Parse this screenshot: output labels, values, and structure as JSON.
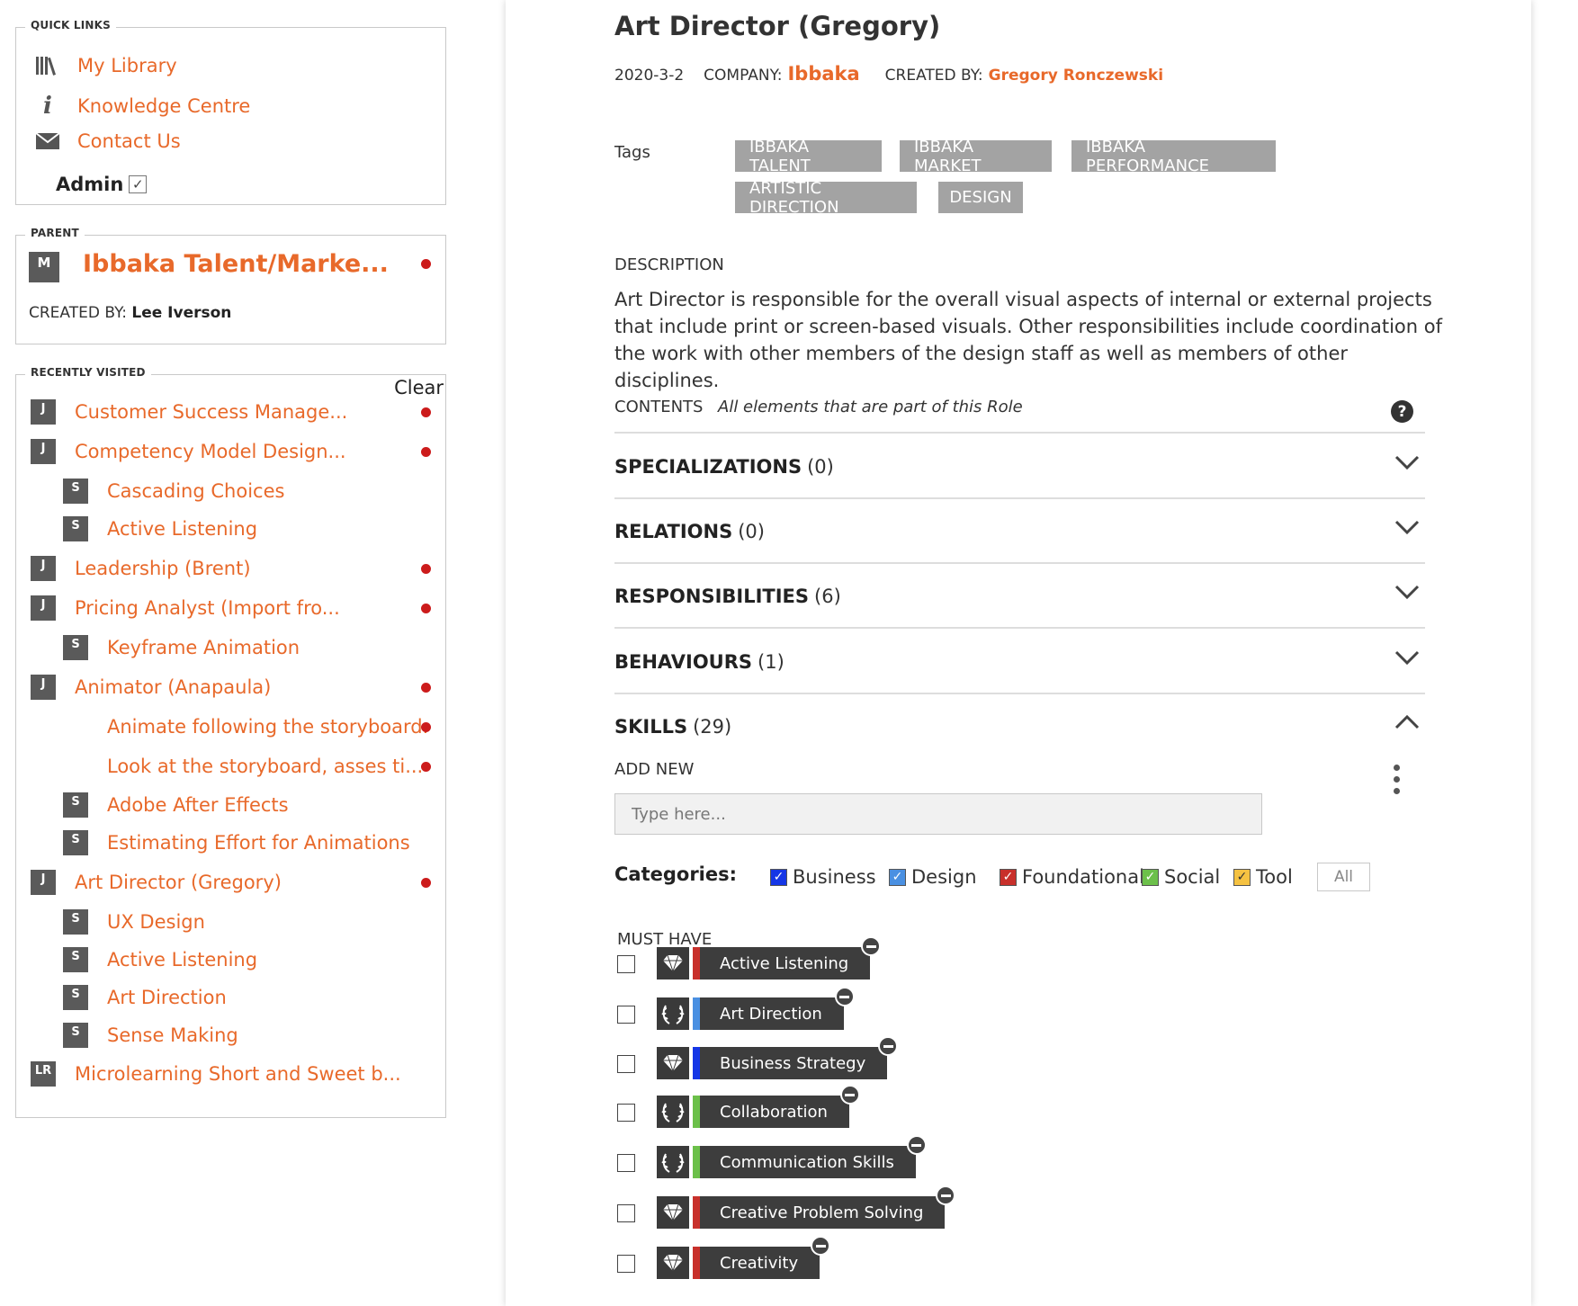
{
  "sidebar": {
    "quick_links": {
      "legend": "QUICK LINKS",
      "items": [
        {
          "label": "My Library",
          "icon": "library-icon"
        },
        {
          "label": "Knowledge Centre",
          "icon": "info-icon"
        },
        {
          "label": "Contact Us",
          "icon": "envelope-icon"
        }
      ],
      "admin_label": "Admin",
      "admin_checked": true
    },
    "parent": {
      "legend": "PARENT",
      "badge": "M",
      "title": "Ibbaka Talent/Marke...",
      "created_by_label": "CREATED BY:",
      "created_by": "Lee Iverson"
    },
    "recently_visited": {
      "legend": "RECENTLY VISITED",
      "clear_label": "Clear",
      "items": [
        {
          "badge": "J",
          "label": "Customer Success Manage...",
          "dot": true
        },
        {
          "badge": "J",
          "label": "Competency Model Design...",
          "dot": true
        },
        {
          "badge": "S",
          "label": "Cascading Choices",
          "dot": false
        },
        {
          "badge": "S",
          "label": "Active Listening",
          "dot": false
        },
        {
          "badge": "J",
          "label": "Leadership (Brent)",
          "dot": true
        },
        {
          "badge": "J",
          "label": "Pricing Analyst (Import fro...",
          "dot": true
        },
        {
          "badge": "S",
          "label": "Keyframe Animation",
          "dot": false
        },
        {
          "badge": "J",
          "label": "Animator (Anapaula)",
          "dot": true
        },
        {
          "badge": "",
          "label": "Animate following the storyboard.",
          "dot": true
        },
        {
          "badge": "",
          "label": "Look at the storyboard, asses ti...",
          "dot": true
        },
        {
          "badge": "S",
          "label": "Adobe After Effects",
          "dot": false
        },
        {
          "badge": "S",
          "label": "Estimating Effort for Animations",
          "dot": false
        },
        {
          "badge": "J",
          "label": "Art Director (Gregory)",
          "dot": true
        },
        {
          "badge": "S",
          "label": "UX Design",
          "dot": false
        },
        {
          "badge": "S",
          "label": "Active Listening",
          "dot": false
        },
        {
          "badge": "S",
          "label": "Art Direction",
          "dot": false
        },
        {
          "badge": "S",
          "label": "Sense Making",
          "dot": false
        },
        {
          "badge": "LR",
          "label": "Microlearning Short and Sweet b...",
          "dot": false
        }
      ]
    }
  },
  "main": {
    "title": "Art Director (Gregory)",
    "date": "2020-3-2",
    "company_label": "COMPANY:",
    "company": "Ibbaka",
    "created_by_label": "CREATED BY:",
    "created_by": "Gregory Ronczewski",
    "tags_label": "Tags",
    "tags": [
      "IBBAKA TALENT",
      "IBBAKA MARKET",
      "IBBAKA PERFORMANCE",
      "ARTISTIC DIRECTION",
      "DESIGN"
    ],
    "description_label": "DESCRIPTION",
    "description": "Art Director is responsible for the overall visual aspects of internal or external projects that include print or screen-based visuals. Other responsibilities include coordination of the work with other members of the design staff as well as members of other disciplines.",
    "contents_label": "CONTENTS",
    "contents_note": "All elements that are part of this Role",
    "sections": [
      {
        "name": "SPECIALIZATIONS",
        "count": "(0)",
        "expanded": false
      },
      {
        "name": "RELATIONS",
        "count": "(0)",
        "expanded": false
      },
      {
        "name": "RESPONSIBILITIES",
        "count": "(6)",
        "expanded": false
      },
      {
        "name": "BEHAVIOURS",
        "count": "(1)",
        "expanded": false
      },
      {
        "name": "SKILLS",
        "count": "(29)",
        "expanded": true
      }
    ],
    "skills": {
      "add_new_label": "ADD NEW",
      "input_placeholder": "Type here...",
      "categories_label": "Categories:",
      "categories": [
        {
          "label": "Business",
          "color": "#1536e6",
          "checked": true
        },
        {
          "label": "Design",
          "color": "#4a90e2",
          "checked": true
        },
        {
          "label": "Foundational",
          "color": "#c8302b",
          "checked": true
        },
        {
          "label": "Social",
          "color": "#6cc04a",
          "checked": true
        },
        {
          "label": "Tool",
          "color": "#f5c242",
          "checked": true
        }
      ],
      "all_label": "All",
      "must_have_label": "MUST HAVE",
      "items": [
        {
          "label": "Active Listening",
          "icon": "diamond-icon",
          "color": "#c8302b"
        },
        {
          "label": "Art Direction",
          "icon": "laurel-icon",
          "color": "#4a90e2"
        },
        {
          "label": "Business Strategy",
          "icon": "diamond-icon",
          "color": "#1536e6"
        },
        {
          "label": "Collaboration",
          "icon": "laurel-icon",
          "color": "#6cc04a"
        },
        {
          "label": "Communication Skills",
          "icon": "laurel-icon",
          "color": "#6cc04a"
        },
        {
          "label": "Creative Problem Solving",
          "icon": "diamond-icon",
          "color": "#c8302b"
        },
        {
          "label": "Creativity",
          "icon": "diamond-icon",
          "color": "#c8302b"
        }
      ]
    }
  }
}
